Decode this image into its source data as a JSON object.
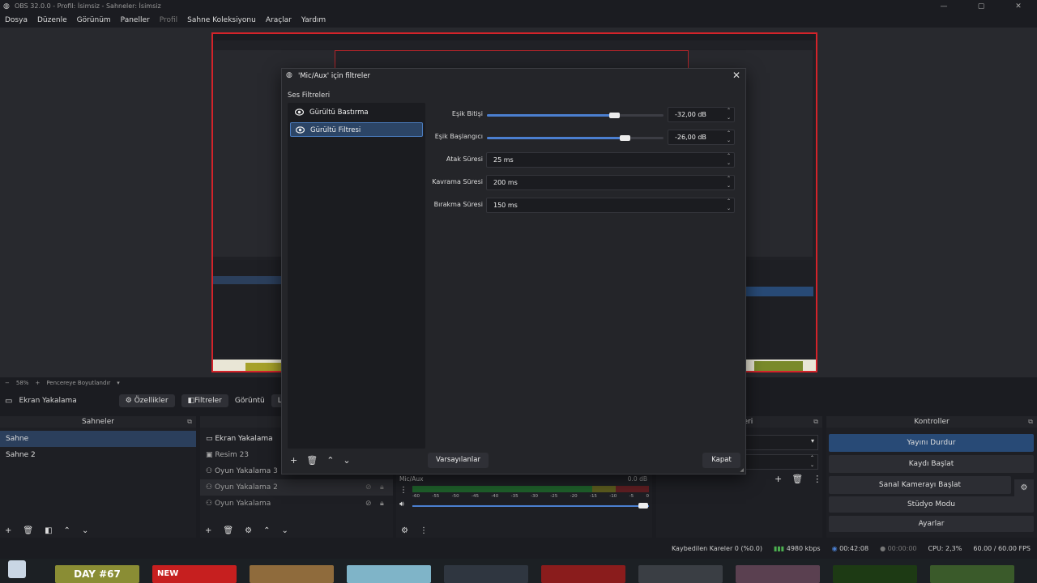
{
  "window": {
    "title": "OBS 32.0.0 - Profil: İsimsiz - Sahneler: İsimsiz",
    "controls": [
      "—",
      "▢",
      "✕"
    ]
  },
  "menu": [
    "Dosya",
    "Düzenle",
    "Görünüm",
    "Paneller",
    "Profil",
    "Sahne Koleksiyonu",
    "Araçlar",
    "Yardım"
  ],
  "zoom": {
    "value": "58%",
    "fit_label": "Pencereye Boyutlandır"
  },
  "source_toolbar": {
    "source_name": "Ekran Yakalama",
    "properties": "Özellikler",
    "filters": "Filtreler",
    "display_label": "Görüntü",
    "display_value": "LEN"
  },
  "scenes": {
    "header": "Sahneler",
    "items": [
      "Sahne",
      "Sahne 2"
    ],
    "selected": 0
  },
  "sources": {
    "header": "Ka",
    "items": [
      "Ekran Yakalama",
      "Resim 23",
      "Oyun Yakalama 3",
      "Oyun Yakalama 2",
      "Oyun Yakalama"
    ]
  },
  "mixer": {
    "header": "leri",
    "channel": "Mic/Aux",
    "db_value": "0.0 dB",
    "ticks": [
      "-60",
      "-55",
      "-50",
      "-45",
      "-40",
      "-35",
      "-30",
      "-25",
      "-20",
      "-15",
      "-10",
      "-5",
      "0"
    ]
  },
  "controls": {
    "header": "Kontroller",
    "buttons": [
      "Yayını Durdur",
      "Kaydı Başlat",
      "Sanal Kamerayı Başlat",
      "Stüdyo Modu",
      "Ayarlar"
    ]
  },
  "status": {
    "dropped": "Kaybedilen Kareler 0 (%0.0)",
    "bitrate": "4980 kbps",
    "stream_time": "00:42:08",
    "rec_time": "00:00:00",
    "cpu": "CPU: 2,3%",
    "fps": "60.00 / 60.00 FPS"
  },
  "dialog": {
    "title": "'Mic/Aux' için filtreler",
    "section": "Ses Filtreleri",
    "filters": [
      "Gürültü Bastırma",
      "Gürültü Filtresi"
    ],
    "selected": 1,
    "props": {
      "close_threshold": {
        "label": "Eşik Bitişi",
        "value": "-32,00 dB",
        "fraction": 0.72
      },
      "open_threshold": {
        "label": "Eşik Başlangıcı",
        "value": "-26,00 dB",
        "fraction": 0.78
      },
      "attack": {
        "label": "Atak Süresi",
        "value": "25 ms"
      },
      "hold": {
        "label": "Kavrama Süresi",
        "value": "200 ms"
      },
      "release": {
        "label": "Bırakma Süresi",
        "value": "150 ms"
      }
    },
    "defaults_button": "Varsayılanlar",
    "close_button": "Kapat"
  },
  "taskbar": {
    "thumb1": "DAY #67",
    "thumb2": "NEW"
  },
  "colors": {
    "accent": "#4b7fd0",
    "selection": "#2b3f5c",
    "preview_border": "#d4232a"
  }
}
